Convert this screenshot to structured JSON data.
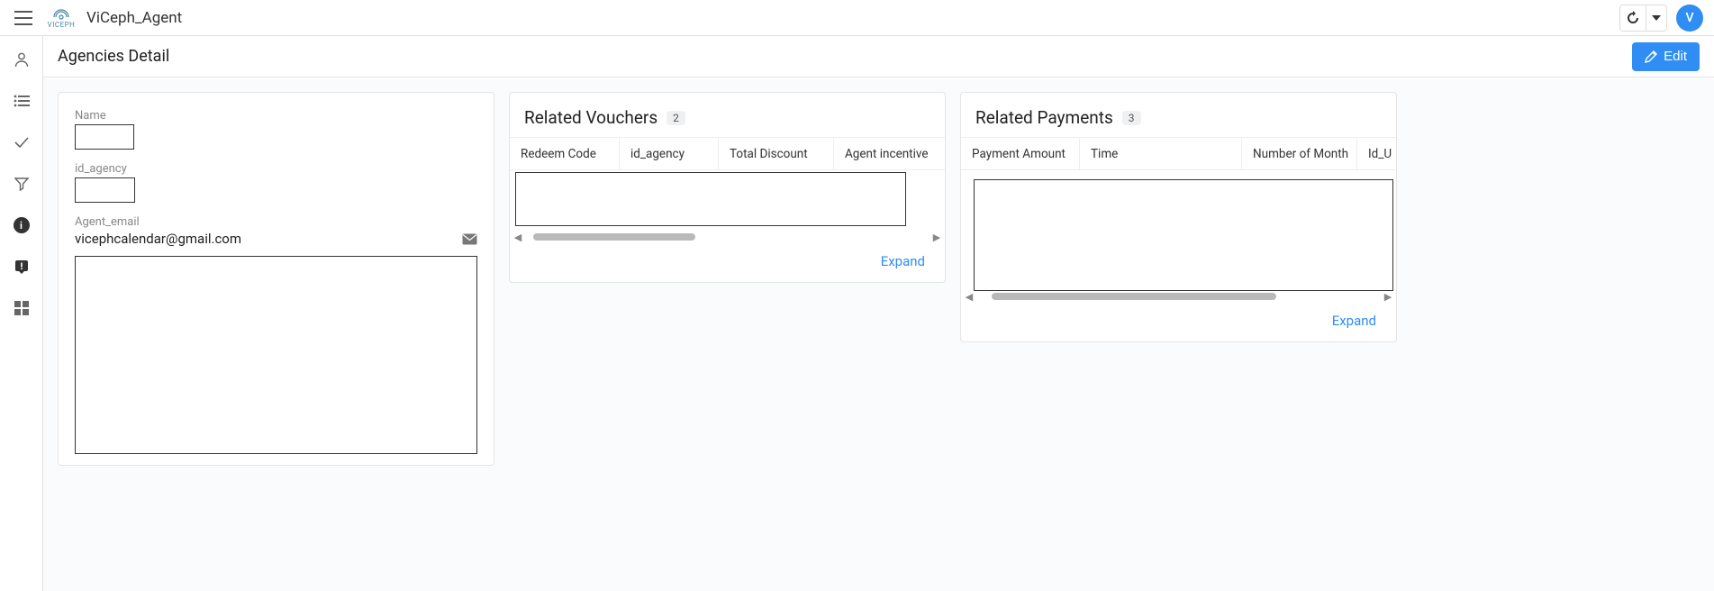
{
  "header": {
    "app_title": "ViCeph_Agent",
    "logo_text": "VICEPH",
    "avatar_initial": "V"
  },
  "page": {
    "title": "Agencies Detail",
    "edit_label": "Edit"
  },
  "detail": {
    "name_label": "Name",
    "id_agency_label": "id_agency",
    "agent_email_label": "Agent_email",
    "agent_email_value": "vicephcalendar@gmail.com"
  },
  "vouchers": {
    "title": "Related Vouchers",
    "count": "2",
    "columns": [
      "Redeem Code",
      "id_agency",
      "Total Discount",
      "Agent incentive"
    ],
    "expand_label": "Expand"
  },
  "payments": {
    "title": "Related Payments",
    "count": "3",
    "columns": [
      "Payment Amount",
      "Time",
      "Number of Month",
      "Id_U"
    ],
    "expand_label": "Expand"
  }
}
